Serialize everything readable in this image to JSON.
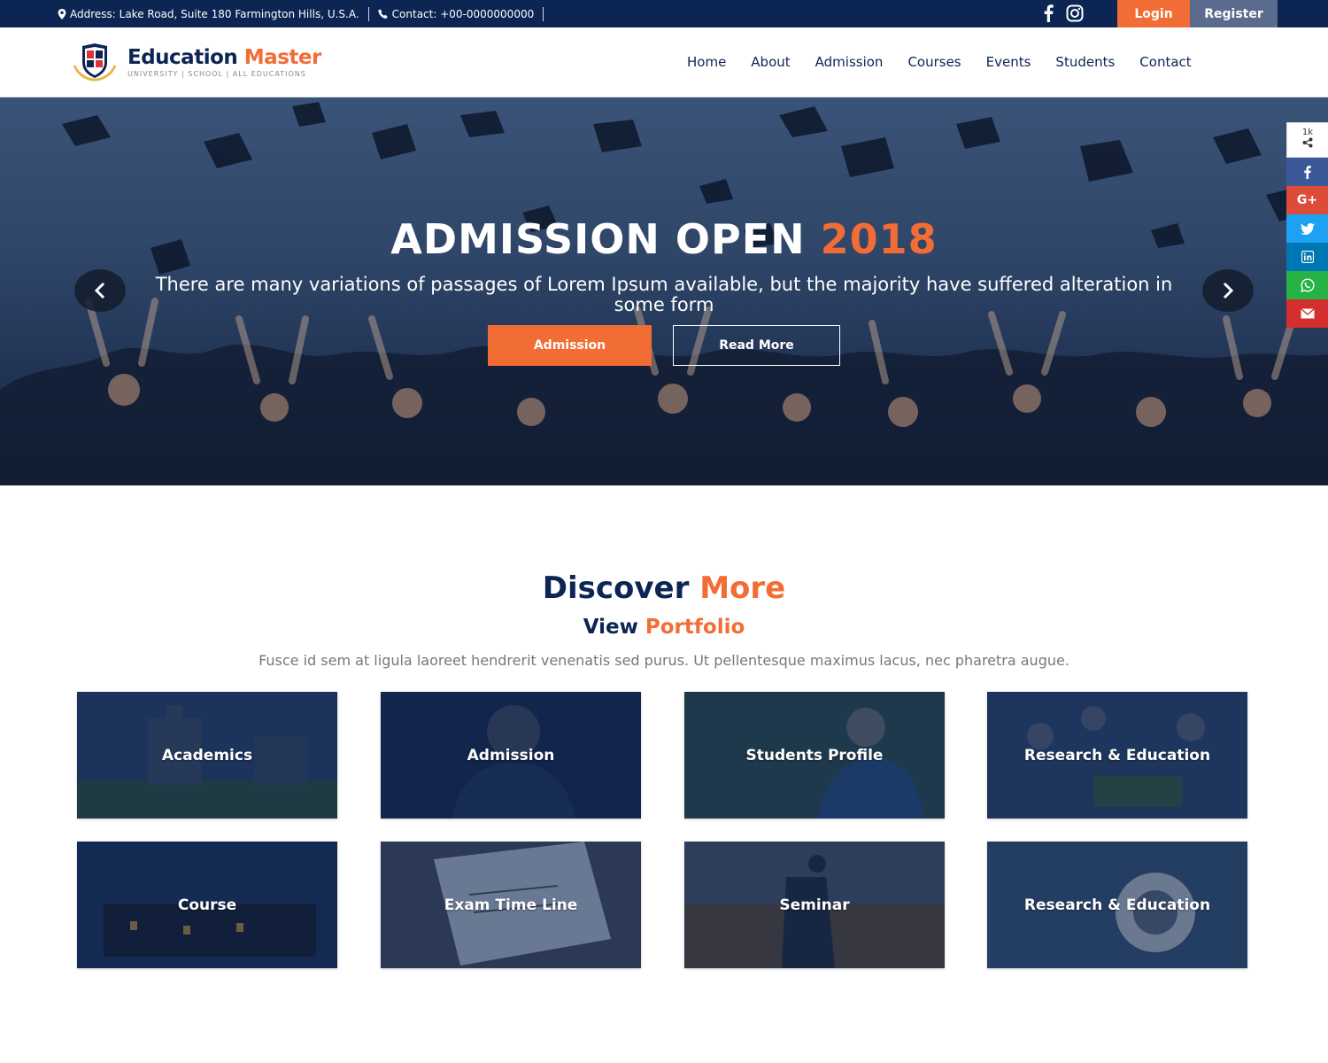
{
  "topbar": {
    "address": "Address: Lake Road, Suite 180 Farmington Hills, U.S.A.",
    "contact": "Contact: +00-0000000000",
    "login": "Login",
    "register": "Register"
  },
  "header": {
    "logo_name_main": "Education",
    "logo_name_accent": "Master",
    "logo_tagline": "UNIVERSITY | SCHOOL | ALL EDUCATIONS",
    "nav": [
      "Home",
      "About",
      "Admission",
      "Courses",
      "Events",
      "Students",
      "Contact"
    ]
  },
  "hero": {
    "title_main": "ADMISSION OPEN",
    "title_accent": "2018",
    "subtitle": "There are many variations of passages of Lorem Ipsum available, but the majority have suffered alteration in some form",
    "btn_admission": "Admission",
    "btn_read_more": "Read More"
  },
  "share": {
    "count": "1k",
    "items": [
      "facebook-icon",
      "google-plus-icon",
      "twitter-icon",
      "linkedin-icon",
      "whatsapp-icon",
      "email-icon"
    ],
    "google_label": "G+"
  },
  "discover": {
    "title_main": "Discover",
    "title_accent": "More",
    "sub_main": "View",
    "sub_accent": "Portfolio",
    "description": "Fusce id sem at ligula laoreet hendrerit venenatis sed purus. Ut pellentesque maximus lacus, nec pharetra augue.",
    "cards": [
      "Academics",
      "Admission",
      "Students Profile",
      "Research & Education",
      "Course",
      "Exam Time Line",
      "Seminar",
      "Research & Education"
    ]
  },
  "colors": {
    "navy": "#0c2553",
    "accent": "#f26c36",
    "facebook": "#3b5998",
    "google": "#dd4b39",
    "twitter": "#1da1f2",
    "linkedin": "#0077b5",
    "whatsapp": "#25b345",
    "email": "#d32f2f"
  }
}
